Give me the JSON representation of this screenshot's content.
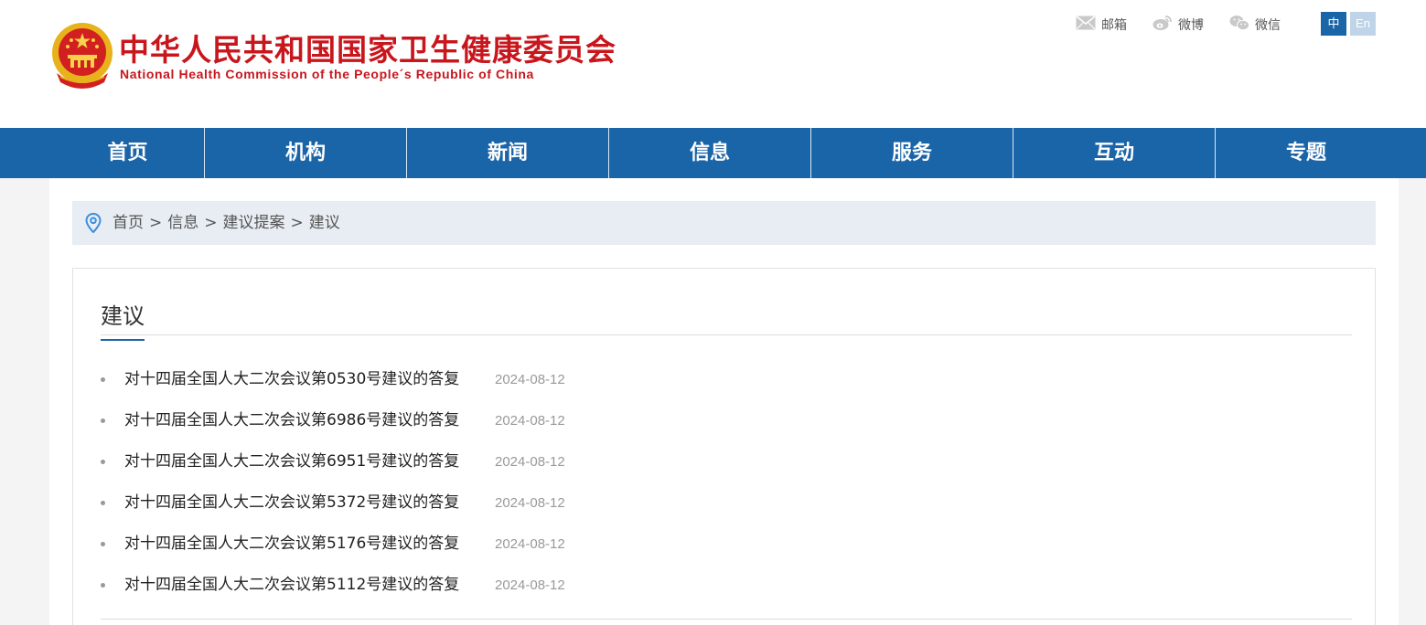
{
  "header": {
    "title_cn": "中华人民共和国国家卫生健康委员会",
    "title_en": "National Health Commission of the People´s Republic of China",
    "links": [
      {
        "label": "邮箱",
        "icon": "mail-icon"
      },
      {
        "label": "微博",
        "icon": "weibo-icon"
      },
      {
        "label": "微信",
        "icon": "wechat-icon"
      }
    ],
    "lang_cn": "中",
    "lang_en": "En"
  },
  "nav": {
    "items": [
      "首页",
      "机构",
      "新闻",
      "信息",
      "服务",
      "互动",
      "专题"
    ]
  },
  "breadcrumb": {
    "items": [
      "首页",
      "信息",
      "建议提案",
      "建议"
    ],
    "separator": ">"
  },
  "panel": {
    "title": "建议",
    "items": [
      {
        "title": "对十四届全国人大二次会议第0530号建议的答复",
        "date": "2024-08-12"
      },
      {
        "title": "对十四届全国人大二次会议第6986号建议的答复",
        "date": "2024-08-12"
      },
      {
        "title": "对十四届全国人大二次会议第6951号建议的答复",
        "date": "2024-08-12"
      },
      {
        "title": "对十四届全国人大二次会议第5372号建议的答复",
        "date": "2024-08-12"
      },
      {
        "title": "对十四届全国人大二次会议第5176号建议的答复",
        "date": "2024-08-12"
      },
      {
        "title": "对十四届全国人大二次会议第5112号建议的答复",
        "date": "2024-08-12"
      }
    ]
  },
  "colors": {
    "brand_red": "#c8161d",
    "nav_blue": "#1a64a8",
    "breadcrumb_bg": "#e8edf3"
  }
}
